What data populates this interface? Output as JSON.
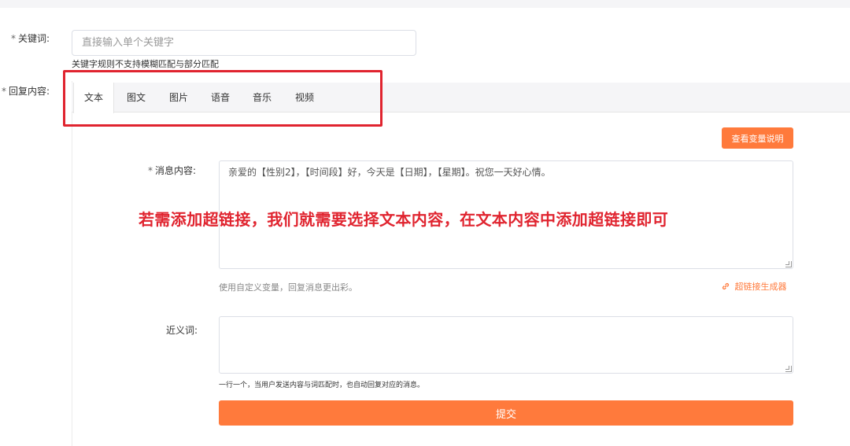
{
  "keyword": {
    "required_mark": "*",
    "label": "关键词:",
    "placeholder": "直接输入单个关键字",
    "hint": "关键字规则不支持模糊匹配与部分匹配"
  },
  "reply": {
    "required_mark": "*",
    "label": "回复内容:",
    "tabs": [
      "文本",
      "图文",
      "图片",
      "语音",
      "音乐",
      "视频"
    ],
    "active_tab": "文本"
  },
  "variable_button": "查看变量说明",
  "message": {
    "required_mark": "*",
    "label": "消息内容:",
    "value": "亲爱的【性别2】，【时间段】好，今天是【日期】，【星期】。祝您一天好心情。",
    "hint": "使用自定义变量，回复消息更出彩。",
    "link_generator": "超链接生成器",
    "link_icon": "link-icon"
  },
  "annotation": "若需添加超链接，我们就需要选择文本内容，在文本内容中添加超链接即可",
  "synonym": {
    "label": "近义词:",
    "value": "",
    "hint": "一行一个，当用户发送内容与词匹配时，也自动回复对应的消息。"
  },
  "submit_label": "提交",
  "colors": {
    "accent": "#ff7a3c",
    "annotation_red": "#e0242f"
  }
}
